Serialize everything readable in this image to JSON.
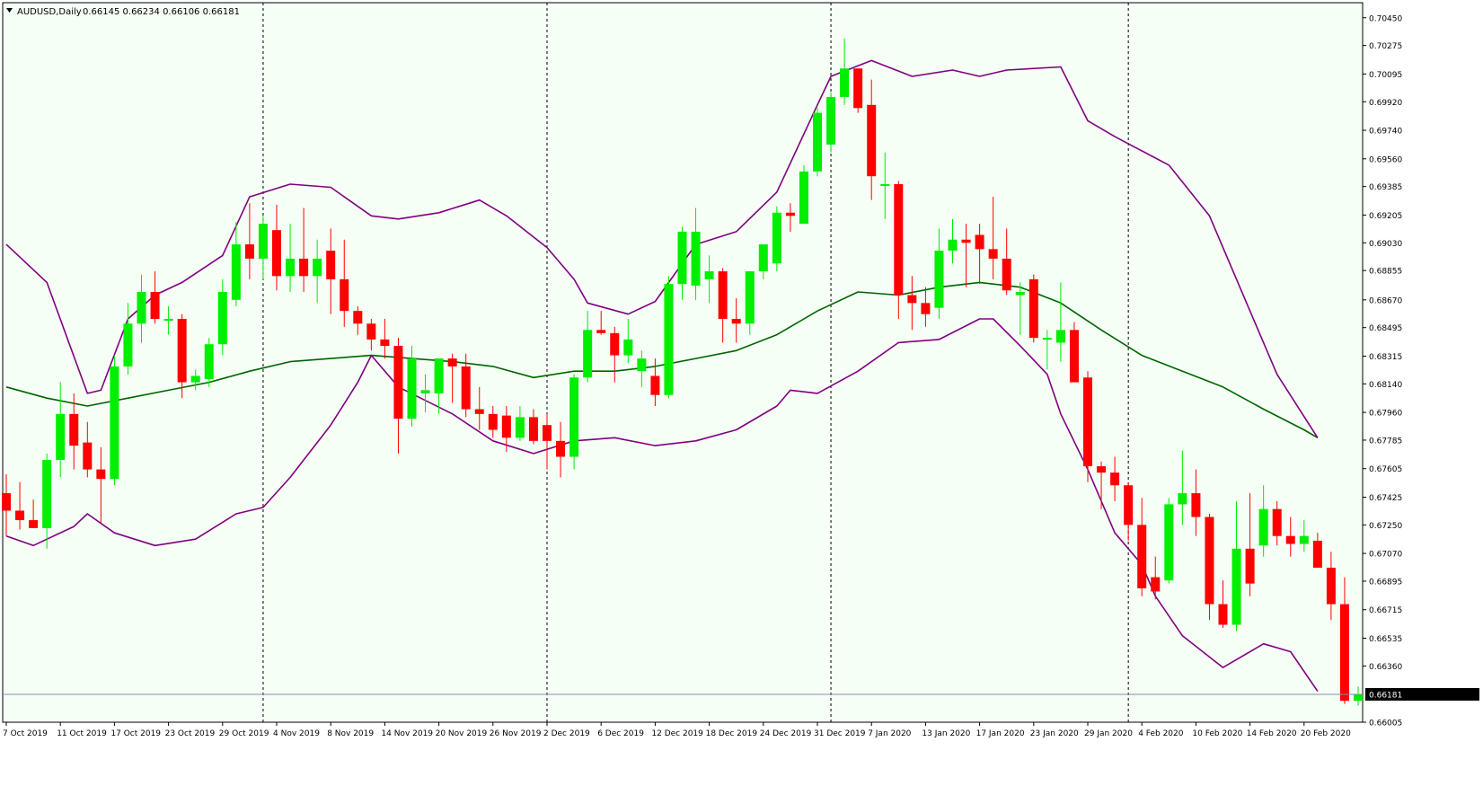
{
  "header": {
    "symbol": "AUDUSD,Daily",
    "ohlc": "0.66145 0.66234 0.66106 0.66181"
  },
  "colors": {
    "background": "#f5fff5",
    "bull": "#00ee00",
    "bear": "#ff0000",
    "bollinger": "#800080",
    "ma": "#006400",
    "grid": "#000000"
  },
  "chart_data": {
    "type": "candlestick",
    "ylim": [
      0.66005,
      0.70545
    ],
    "y_ticks": [
      "0.70450",
      "0.70275",
      "0.70095",
      "0.69920",
      "0.69740",
      "0.69560",
      "0.69385",
      "0.69205",
      "0.69030",
      "0.68855",
      "0.68670",
      "0.68495",
      "0.68315",
      "0.68140",
      "0.67960",
      "0.67785",
      "0.67605",
      "0.67425",
      "0.67250",
      "0.67070",
      "0.66895",
      "0.66715",
      "0.66535",
      "0.66360",
      "0.66005"
    ],
    "current_price": "0.66181",
    "x_labels": [
      "7 Oct 2019",
      "11 Oct 2019",
      "17 Oct 2019",
      "23 Oct 2019",
      "29 Oct 2019",
      "4 Nov 2019",
      "8 Nov 2019",
      "14 Nov 2019",
      "20 Nov 2019",
      "26 Nov 2019",
      "2 Dec 2019",
      "6 Dec 2019",
      "12 Dec 2019",
      "18 Dec 2019",
      "24 Dec 2019",
      "31 Dec 2019",
      "7 Jan 2020",
      "13 Jan 2020",
      "17 Jan 2020",
      "23 Jan 2020",
      "29 Jan 2020",
      "4 Feb 2020",
      "10 Feb 2020",
      "14 Feb 2020",
      "20 Feb 2020"
    ],
    "x_label_index": [
      0,
      4,
      8,
      12,
      16,
      20,
      24,
      28,
      32,
      36,
      40,
      44,
      48,
      52,
      56,
      60,
      64,
      68,
      72,
      76,
      80,
      84,
      88,
      92,
      96
    ],
    "separator_index": [
      19,
      40,
      61,
      83
    ],
    "candles": [
      [
        0.6745,
        0.6757,
        0.6718,
        0.6734
      ],
      [
        0.6734,
        0.6752,
        0.6722,
        0.6728
      ],
      [
        0.6728,
        0.6741,
        0.6723,
        0.6723
      ],
      [
        0.6723,
        0.677,
        0.671,
        0.6766
      ],
      [
        0.6766,
        0.6815,
        0.6755,
        0.6795
      ],
      [
        0.6795,
        0.6808,
        0.676,
        0.6775
      ],
      [
        0.6777,
        0.679,
        0.6755,
        0.676
      ],
      [
        0.676,
        0.6774,
        0.6726,
        0.6754
      ],
      [
        0.6754,
        0.6832,
        0.675,
        0.6825
      ],
      [
        0.6825,
        0.6865,
        0.682,
        0.6852
      ],
      [
        0.6852,
        0.6883,
        0.684,
        0.6872
      ],
      [
        0.6872,
        0.6885,
        0.6852,
        0.6855
      ],
      [
        0.6855,
        0.6863,
        0.6845,
        0.6855
      ],
      [
        0.6855,
        0.6858,
        0.6805,
        0.6815
      ],
      [
        0.6815,
        0.6823,
        0.681,
        0.6819
      ],
      [
        0.6817,
        0.6843,
        0.6812,
        0.6839
      ],
      [
        0.6839,
        0.688,
        0.6832,
        0.6872
      ],
      [
        0.6867,
        0.6916,
        0.6863,
        0.6902
      ],
      [
        0.6902,
        0.6928,
        0.688,
        0.6893
      ],
      [
        0.6893,
        0.692,
        0.688,
        0.6915
      ],
      [
        0.6911,
        0.6927,
        0.6873,
        0.6882
      ],
      [
        0.6882,
        0.6915,
        0.6872,
        0.6893
      ],
      [
        0.6893,
        0.6925,
        0.6872,
        0.6882
      ],
      [
        0.6882,
        0.6905,
        0.6865,
        0.6893
      ],
      [
        0.6898,
        0.6912,
        0.6858,
        0.688
      ],
      [
        0.688,
        0.6905,
        0.685,
        0.686
      ],
      [
        0.686,
        0.6863,
        0.6845,
        0.6852
      ],
      [
        0.6852,
        0.6855,
        0.6835,
        0.6842
      ],
      [
        0.6842,
        0.6855,
        0.683,
        0.6838
      ],
      [
        0.6838,
        0.6843,
        0.677,
        0.6792
      ],
      [
        0.6792,
        0.6838,
        0.6787,
        0.683
      ],
      [
        0.6808,
        0.682,
        0.6796,
        0.681
      ],
      [
        0.6808,
        0.683,
        0.6795,
        0.683
      ],
      [
        0.683,
        0.6833,
        0.6802,
        0.6825
      ],
      [
        0.6825,
        0.6833,
        0.6793,
        0.6798
      ],
      [
        0.6798,
        0.6812,
        0.6785,
        0.6795
      ],
      [
        0.6795,
        0.68,
        0.678,
        0.6785
      ],
      [
        0.6794,
        0.68,
        0.6771,
        0.678
      ],
      [
        0.678,
        0.68,
        0.6778,
        0.6793
      ],
      [
        0.6793,
        0.6798,
        0.6776,
        0.6778
      ],
      [
        0.6788,
        0.6795,
        0.676,
        0.6778
      ],
      [
        0.6778,
        0.679,
        0.6755,
        0.6768
      ],
      [
        0.6768,
        0.682,
        0.676,
        0.6818
      ],
      [
        0.6818,
        0.686,
        0.6815,
        0.6848
      ],
      [
        0.6848,
        0.686,
        0.6845,
        0.6846
      ],
      [
        0.6846,
        0.685,
        0.6815,
        0.6832
      ],
      [
        0.6832,
        0.6855,
        0.6827,
        0.6842
      ],
      [
        0.6822,
        0.6835,
        0.6812,
        0.683
      ],
      [
        0.6819,
        0.683,
        0.68,
        0.6807
      ],
      [
        0.6807,
        0.6882,
        0.6805,
        0.6877
      ],
      [
        0.6877,
        0.6913,
        0.6867,
        0.691
      ],
      [
        0.6876,
        0.6925,
        0.6867,
        0.691
      ],
      [
        0.688,
        0.6895,
        0.6865,
        0.6885
      ],
      [
        0.6885,
        0.6887,
        0.684,
        0.6855
      ],
      [
        0.6855,
        0.6868,
        0.684,
        0.6852
      ],
      [
        0.6852,
        0.6885,
        0.6845,
        0.6885
      ],
      [
        0.6885,
        0.689,
        0.688,
        0.6902
      ],
      [
        0.689,
        0.6926,
        0.6885,
        0.6922
      ],
      [
        0.6922,
        0.6928,
        0.691,
        0.692
      ],
      [
        0.6915,
        0.6952,
        0.6915,
        0.6948
      ],
      [
        0.6948,
        0.6988,
        0.6945,
        0.6985
      ],
      [
        0.6965,
        0.6998,
        0.696,
        0.6995
      ],
      [
        0.6995,
        0.7032,
        0.699,
        0.7013
      ],
      [
        0.7013,
        0.701,
        0.6985,
        0.6988
      ],
      [
        0.699,
        0.7006,
        0.693,
        0.6945
      ],
      [
        0.694,
        0.696,
        0.6918,
        0.694
      ],
      [
        0.694,
        0.6942,
        0.6855,
        0.687
      ],
      [
        0.687,
        0.6882,
        0.6848,
        0.6865
      ],
      [
        0.6865,
        0.6875,
        0.685,
        0.6858
      ],
      [
        0.6862,
        0.6912,
        0.6855,
        0.6898
      ],
      [
        0.6898,
        0.6918,
        0.689,
        0.6905
      ],
      [
        0.6905,
        0.6915,
        0.6875,
        0.6903
      ],
      [
        0.6908,
        0.6915,
        0.6877,
        0.6899
      ],
      [
        0.6899,
        0.6932,
        0.688,
        0.6893
      ],
      [
        0.6893,
        0.6912,
        0.687,
        0.6873
      ],
      [
        0.687,
        0.6878,
        0.6845,
        0.6872
      ],
      [
        0.688,
        0.6883,
        0.684,
        0.6843
      ],
      [
        0.6843,
        0.6848,
        0.6823,
        0.6843
      ],
      [
        0.684,
        0.6878,
        0.6828,
        0.6848
      ],
      [
        0.6848,
        0.6853,
        0.6818,
        0.6815
      ],
      [
        0.6818,
        0.6822,
        0.6752,
        0.6762
      ],
      [
        0.6762,
        0.6765,
        0.6735,
        0.6758
      ],
      [
        0.6758,
        0.6768,
        0.674,
        0.675
      ],
      [
        0.675,
        0.6752,
        0.6715,
        0.6725
      ],
      [
        0.6725,
        0.6742,
        0.668,
        0.6685
      ],
      [
        0.6692,
        0.6705,
        0.6678,
        0.6683
      ],
      [
        0.669,
        0.6742,
        0.6688,
        0.6738
      ],
      [
        0.6738,
        0.6772,
        0.6725,
        0.6745
      ],
      [
        0.6745,
        0.676,
        0.6718,
        0.673
      ],
      [
        0.673,
        0.6732,
        0.6665,
        0.6675
      ],
      [
        0.6675,
        0.669,
        0.666,
        0.6662
      ],
      [
        0.6662,
        0.674,
        0.6658,
        0.671
      ],
      [
        0.671,
        0.6745,
        0.668,
        0.6688
      ],
      [
        0.6712,
        0.675,
        0.6705,
        0.6735
      ],
      [
        0.6735,
        0.674,
        0.6712,
        0.6718
      ],
      [
        0.6718,
        0.673,
        0.6705,
        0.6713
      ],
      [
        0.6713,
        0.6728,
        0.6708,
        0.6718
      ],
      [
        0.6715,
        0.672,
        0.67,
        0.6698
      ],
      [
        0.6698,
        0.6708,
        0.6665,
        0.6675
      ],
      [
        0.6675,
        0.6692,
        0.6612,
        0.6614
      ],
      [
        0.6614,
        0.6623,
        0.6611,
        0.6618
      ]
    ],
    "bollinger_upper": [
      [
        0,
        0.6902
      ],
      [
        3,
        0.6878
      ],
      [
        6,
        0.6808
      ],
      [
        7,
        0.681
      ],
      [
        9,
        0.6855
      ],
      [
        11,
        0.687
      ],
      [
        13,
        0.6878
      ],
      [
        16,
        0.6895
      ],
      [
        18,
        0.6932
      ],
      [
        21,
        0.694
      ],
      [
        24,
        0.6938
      ],
      [
        27,
        0.692
      ],
      [
        29,
        0.6918
      ],
      [
        32,
        0.6922
      ],
      [
        35,
        0.693
      ],
      [
        37,
        0.692
      ],
      [
        40,
        0.69
      ],
      [
        42,
        0.688
      ],
      [
        43,
        0.6865
      ],
      [
        46,
        0.6858
      ],
      [
        48,
        0.6866
      ],
      [
        51,
        0.6902
      ],
      [
        54,
        0.691
      ],
      [
        57,
        0.6935
      ],
      [
        60,
        0.699
      ],
      [
        61,
        0.7008
      ],
      [
        64,
        0.7018
      ],
      [
        67,
        0.7008
      ],
      [
        70,
        0.7012
      ],
      [
        72,
        0.7008
      ],
      [
        74,
        0.7012
      ],
      [
        78,
        0.7014
      ],
      [
        80,
        0.698
      ],
      [
        82,
        0.697
      ],
      [
        86,
        0.6952
      ],
      [
        89,
        0.692
      ],
      [
        92,
        0.686
      ],
      [
        94,
        0.682
      ],
      [
        97,
        0.678
      ]
    ],
    "bollinger_middle": [
      [
        0,
        0.6812
      ],
      [
        3,
        0.6805
      ],
      [
        6,
        0.68
      ],
      [
        9,
        0.6805
      ],
      [
        12,
        0.681
      ],
      [
        15,
        0.6815
      ],
      [
        18,
        0.6822
      ],
      [
        21,
        0.6828
      ],
      [
        24,
        0.683
      ],
      [
        27,
        0.6832
      ],
      [
        30,
        0.683
      ],
      [
        33,
        0.6828
      ],
      [
        36,
        0.6825
      ],
      [
        39,
        0.6818
      ],
      [
        42,
        0.6822
      ],
      [
        45,
        0.6822
      ],
      [
        48,
        0.6825
      ],
      [
        51,
        0.683
      ],
      [
        54,
        0.6835
      ],
      [
        57,
        0.6845
      ],
      [
        60,
        0.686
      ],
      [
        63,
        0.6872
      ],
      [
        66,
        0.687
      ],
      [
        69,
        0.6875
      ],
      [
        72,
        0.6878
      ],
      [
        75,
        0.6875
      ],
      [
        78,
        0.6865
      ],
      [
        81,
        0.6848
      ],
      [
        84,
        0.6832
      ],
      [
        87,
        0.6822
      ],
      [
        90,
        0.6812
      ],
      [
        93,
        0.6798
      ],
      [
        96,
        0.6785
      ],
      [
        97,
        0.678
      ]
    ],
    "bollinger_lower": [
      [
        0,
        0.6718
      ],
      [
        2,
        0.6712
      ],
      [
        5,
        0.6724
      ],
      [
        6,
        0.6732
      ],
      [
        8,
        0.672
      ],
      [
        11,
        0.6712
      ],
      [
        14,
        0.6716
      ],
      [
        17,
        0.6732
      ],
      [
        19,
        0.6736
      ],
      [
        21,
        0.6755
      ],
      [
        24,
        0.6788
      ],
      [
        26,
        0.6815
      ],
      [
        27,
        0.6832
      ],
      [
        29,
        0.6812
      ],
      [
        33,
        0.6795
      ],
      [
        36,
        0.6778
      ],
      [
        39,
        0.677
      ],
      [
        42,
        0.6778
      ],
      [
        45,
        0.678
      ],
      [
        48,
        0.6775
      ],
      [
        51,
        0.6778
      ],
      [
        54,
        0.6785
      ],
      [
        57,
        0.68
      ],
      [
        58,
        0.681
      ],
      [
        60,
        0.6808
      ],
      [
        63,
        0.6822
      ],
      [
        66,
        0.684
      ],
      [
        69,
        0.6842
      ],
      [
        72,
        0.6855
      ],
      [
        73,
        0.6855
      ],
      [
        75,
        0.6838
      ],
      [
        77,
        0.682
      ],
      [
        78,
        0.6795
      ],
      [
        80,
        0.676
      ],
      [
        82,
        0.672
      ],
      [
        84,
        0.67
      ],
      [
        85,
        0.668
      ],
      [
        87,
        0.6655
      ],
      [
        90,
        0.6635
      ],
      [
        93,
        0.665
      ],
      [
        95,
        0.6645
      ],
      [
        97,
        0.662
      ]
    ]
  }
}
